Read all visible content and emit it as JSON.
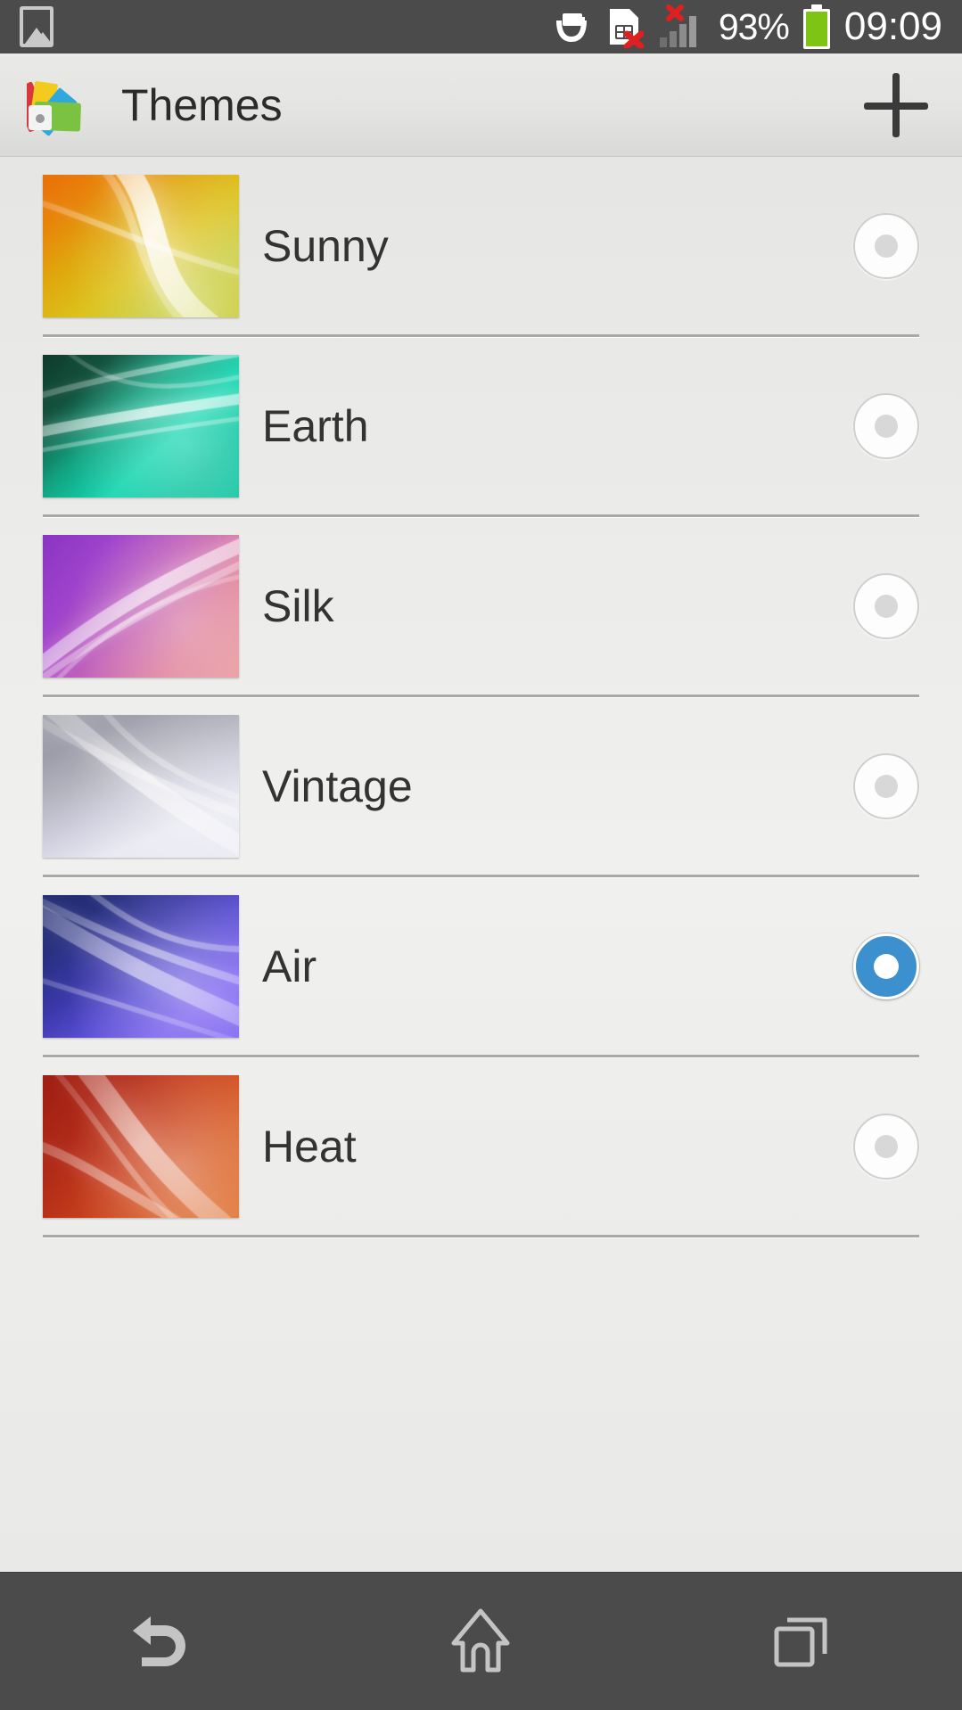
{
  "statusbar": {
    "battery_percent": "93%",
    "time": "09:09",
    "icons": [
      {
        "name": "photo-notification-icon",
        "label": "photo"
      },
      {
        "name": "battery-care-icon",
        "label": "battery care"
      },
      {
        "name": "sim-card-error-icon",
        "label": "no sim card"
      },
      {
        "name": "signal-bars-no-service-icon",
        "label": "no service"
      },
      {
        "name": "battery-icon",
        "label": "battery"
      }
    ],
    "colors": {
      "bg": "#4b4b4b",
      "text": "#ffffff",
      "battery": "#7ec414",
      "error": "#e02020"
    }
  },
  "actionbar": {
    "title": "Themes",
    "app_icon": "themes-swatch-icon",
    "add_label": "+",
    "add_name": "add-theme-button"
  },
  "themes": [
    {
      "name": "Sunny",
      "selected": false,
      "colors": [
        "#e8700a",
        "#e8860b",
        "#e0a90e",
        "#dcc21a",
        "#c9cc3a"
      ],
      "style": "orange-yellow"
    },
    {
      "name": "Earth",
      "selected": false,
      "colors": [
        "#0e3a2c",
        "#14543f",
        "#12a583",
        "#14d6b0",
        "#0fc4a0"
      ],
      "style": "green-teal"
    },
    {
      "name": "Silk",
      "selected": false,
      "colors": [
        "#8b35c4",
        "#a044cc",
        "#c463b8",
        "#e0809a",
        "#e89a9c"
      ],
      "style": "purple-pink"
    },
    {
      "name": "Vintage",
      "selected": false,
      "colors": [
        "#a5a5ae",
        "#9d9daa",
        "#b4b4bf",
        "#cecedd",
        "#e8e8f2"
      ],
      "style": "gray-lavender"
    },
    {
      "name": "Air",
      "selected": true,
      "colors": [
        "#1f2a6e",
        "#27307e",
        "#3a38a8",
        "#5b4fd6",
        "#7a5ff0"
      ],
      "style": "navy-violet"
    },
    {
      "name": "Heat",
      "selected": false,
      "colors": [
        "#9e1f14",
        "#b02a18",
        "#c8401c",
        "#d85a22",
        "#e0702c"
      ],
      "style": "red-orange"
    }
  ],
  "selected_theme": "Air",
  "accent_color": "#3d90ce",
  "navbar": {
    "buttons": [
      {
        "name": "nav-back-button",
        "label": "Back"
      },
      {
        "name": "nav-home-button",
        "label": "Home"
      },
      {
        "name": "nav-recents-button",
        "label": "Recent apps"
      }
    ]
  }
}
